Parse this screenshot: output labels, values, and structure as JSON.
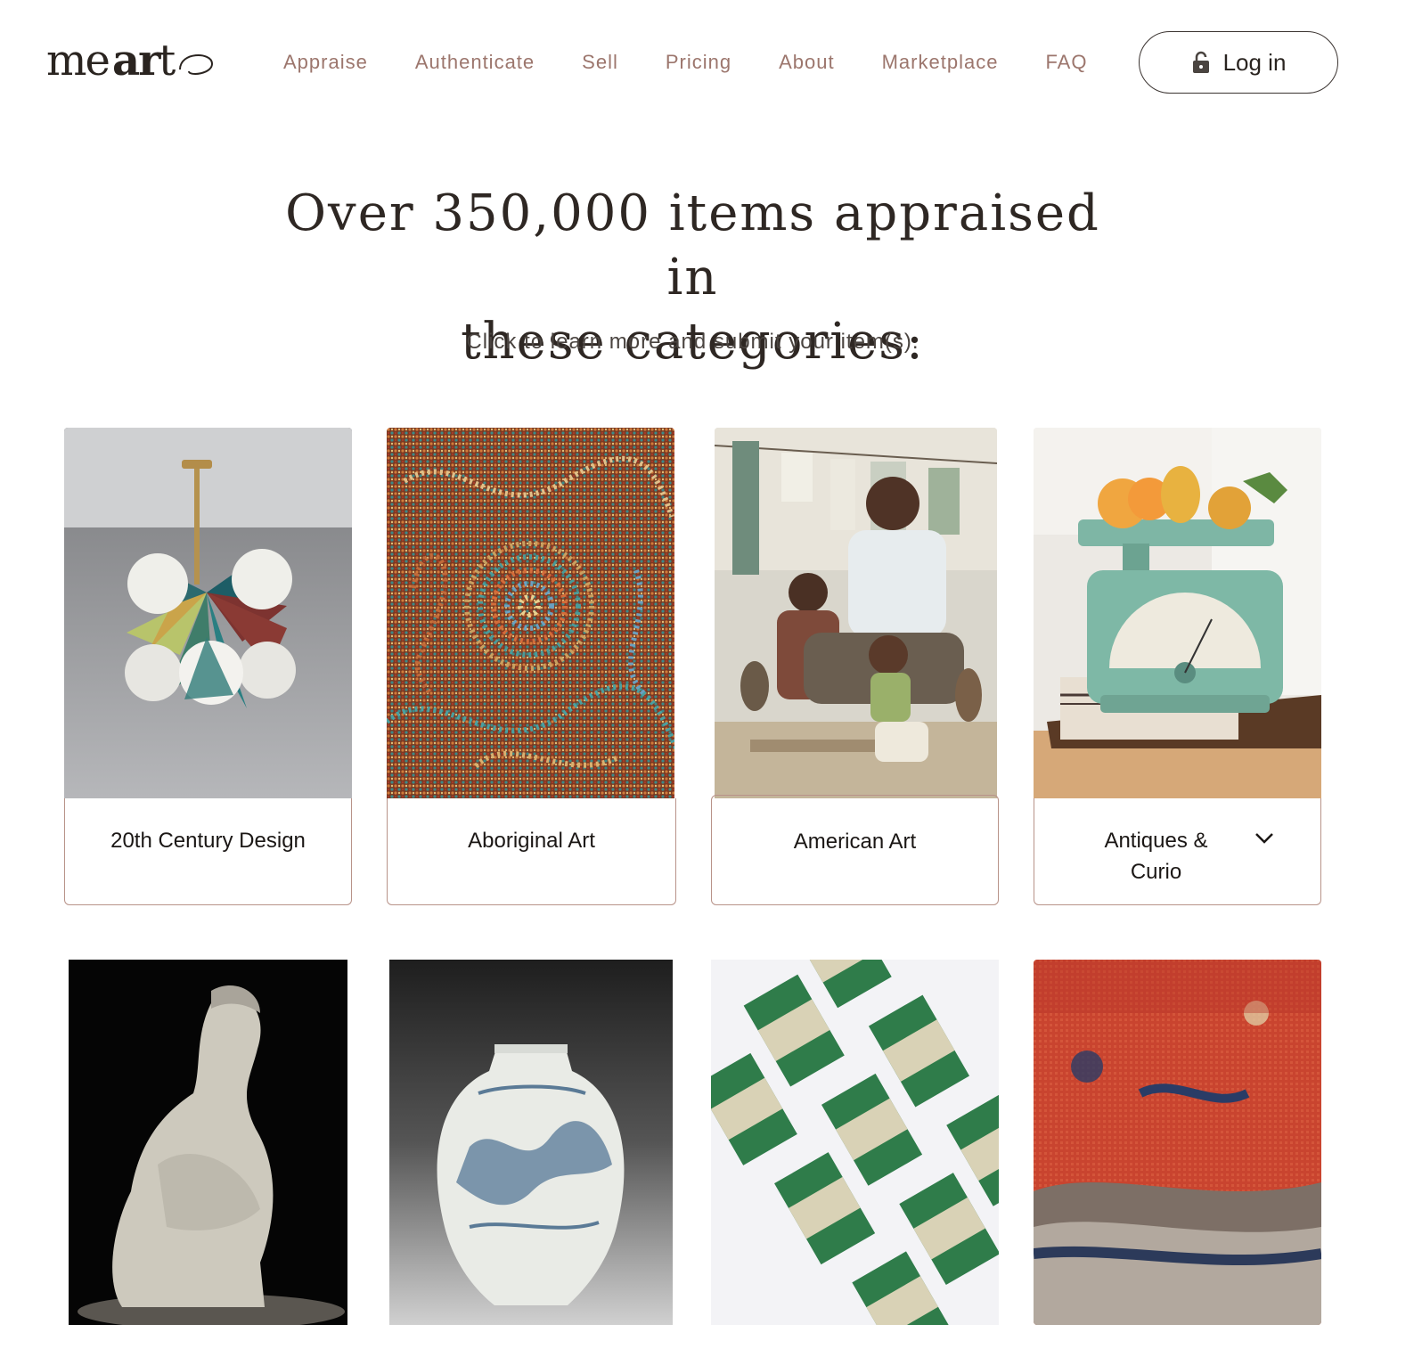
{
  "header": {
    "logo_text": "mearto",
    "nav": [
      "Appraise",
      "Authenticate",
      "Sell",
      "Pricing",
      "About",
      "Marketplace",
      "FAQ"
    ],
    "login_label": "Log in"
  },
  "hero": {
    "title_line1": "Over 350,000 items appraised in",
    "title_line2": "these categories:",
    "subtitle": "Click to learn more and submit your item(s)."
  },
  "categories": [
    {
      "label": "20th Century Design"
    },
    {
      "label": "Aboriginal Art"
    },
    {
      "label": "American Art"
    },
    {
      "label": "Antiques &",
      "label2": "Curio"
    }
  ],
  "colors": {
    "nav_text": "#9c766d",
    "card_border": "#b89389",
    "heading": "#2e2723"
  }
}
